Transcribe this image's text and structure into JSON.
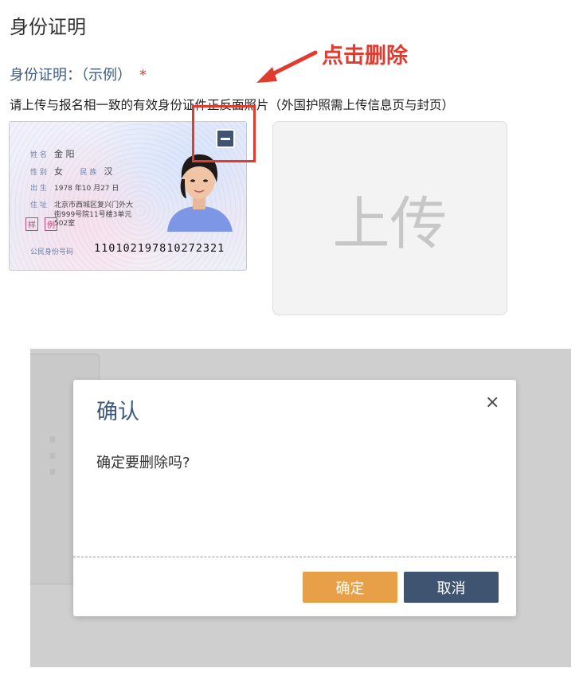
{
  "page": {
    "title": "身份证明",
    "section_label": "身份证明：（示例）",
    "required_mark": "*",
    "instructions": "请上传与报名相一致的有效身份证件正反面照片（外国护照需上传信息页与封页）"
  },
  "annotation": {
    "text": "点击删除"
  },
  "id_card": {
    "name_key": "姓 名",
    "name": "金 阳",
    "sex_key": "性 别",
    "sex": "女",
    "ethnicity_key": "民 族",
    "ethnicity": "汉",
    "birth_key": "出 生",
    "birth": "1978  年10  月27  日",
    "address_key": "住 址",
    "address_line1": "北京市西城区复兴门外大",
    "address_line2": "街999号院11号楼3单元",
    "address_line3": "502室",
    "stamp1": "样",
    "stamp2": "例",
    "id_number_key": "公民身份号码",
    "id_number": "110102197810272321"
  },
  "upload_tile": {
    "label": "上传"
  },
  "modal": {
    "title": "确认",
    "close_glyph": "×",
    "message": "确定要删除吗?",
    "confirm_label": "确定",
    "cancel_label": "取消"
  },
  "colors": {
    "accent_blue": "#3d5a80",
    "annotation_red": "#e03b2f",
    "confirm_orange": "#e8a048",
    "cancel_navy": "#3f5471"
  }
}
